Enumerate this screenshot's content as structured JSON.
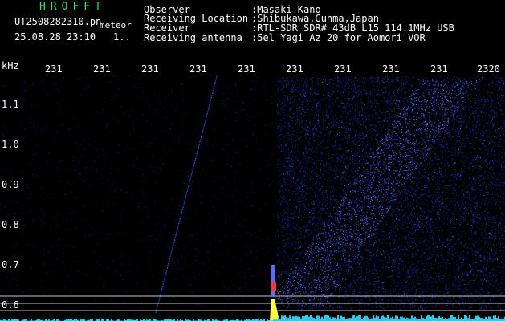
{
  "header": {
    "program_name": "HROFFT",
    "filename": "UT2508282310.pn",
    "datetime": "25.08.28 23:10",
    "counter": "1..",
    "mode": "meteor",
    "labels": {
      "observer": "Observer",
      "location": "Receiving Location",
      "receiver": "Receiver",
      "antenna": "Receiving antenna"
    },
    "values": {
      "observer": ":Masaki Kano",
      "location": ":Shibukawa,Gunma,Japan",
      "receiver": ":RTL-SDR SDR# 43dB L15 114.1MHz USB",
      "antenna": ":5el Yagi Az 20 for Aomori VOR"
    }
  },
  "axes": {
    "y_unit": "kHz",
    "y_ticks": [
      "1.1",
      "1.0",
      "0.9",
      "0.8",
      "0.7",
      "0.6"
    ],
    "x_ticks": [
      "231",
      "231",
      "231",
      "231",
      "231",
      "231",
      "231",
      "231",
      "231",
      "2320"
    ]
  },
  "colors": {
    "background": "#000000",
    "noise_dots": "#1a2a9a",
    "trace": "#2d4bd8",
    "baseline": "#2ec8e8",
    "burst_core": "#ffff40",
    "burst_red": "#ff3040",
    "ref_lines": "#c8c8c8"
  }
}
